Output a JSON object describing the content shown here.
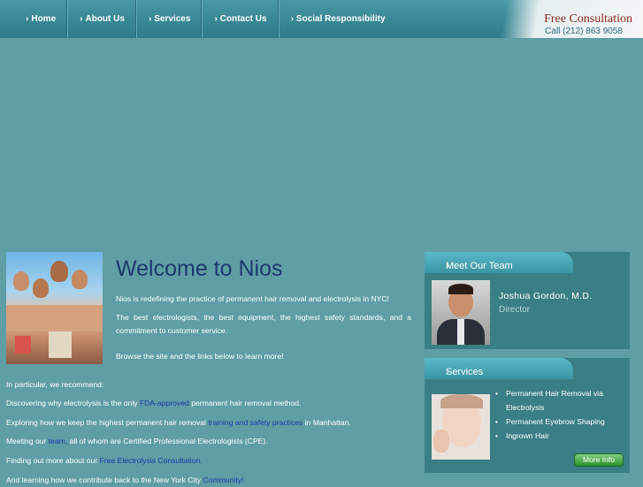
{
  "nav": {
    "items": [
      {
        "label": "Home"
      },
      {
        "label": "About Us"
      },
      {
        "label": "Services"
      },
      {
        "label": "Contact Us"
      },
      {
        "label": "Social Responsibility"
      }
    ],
    "arrow": "›"
  },
  "consult": {
    "title": "Free Consultation",
    "phone": "Call (212) 863 9058"
  },
  "main": {
    "heading": "Welcome to Nios",
    "intro": "Nios is redefining the practice of permanent hair removal and electrolysis in NYC!",
    "best": "The best electrologists, the best equipment, the highest safety standards, and a commitment to customer service.",
    "browse": "Browse the site and the links below to learn more!",
    "recommend": "In particular, we recommend:",
    "l1_pre": "Discovering why electrolysis is the only ",
    "l1_link": "FDA-approved",
    "l1_post": " permanent hair removal method.",
    "l2_pre": "Exploring how we keep the highest permanent hair removal ",
    "l2_link": "training and safety practices",
    "l2_post": " in Manhattan.",
    "l3_pre": "Meeting our ",
    "l3_link": "team,",
    "l3_post": " all of whom are Certified Professional Electrologists (CPE).",
    "l4_pre": "Finding out more about our ",
    "l4_link": "Free Electrolysis Consultation.",
    "l5_pre": "And learning how we contribute back to the New York City ",
    "l5_link": "Community!"
  },
  "team": {
    "heading": "Meet Our Team",
    "name": "Joshua Gordon, M.D.",
    "role": "Director"
  },
  "services": {
    "heading": "Services",
    "items": [
      "Permanent Hair Removal via Electrolysis",
      "Permanent Eyebrow Shaping",
      "Ingrown Hair"
    ],
    "more_label": "More Info"
  },
  "colors": {
    "background": "#5f9ea5",
    "nav": "#3a8a97",
    "heading": "#1b3a6e",
    "link": "#1a3aa8",
    "button": "#2f8f2f"
  }
}
